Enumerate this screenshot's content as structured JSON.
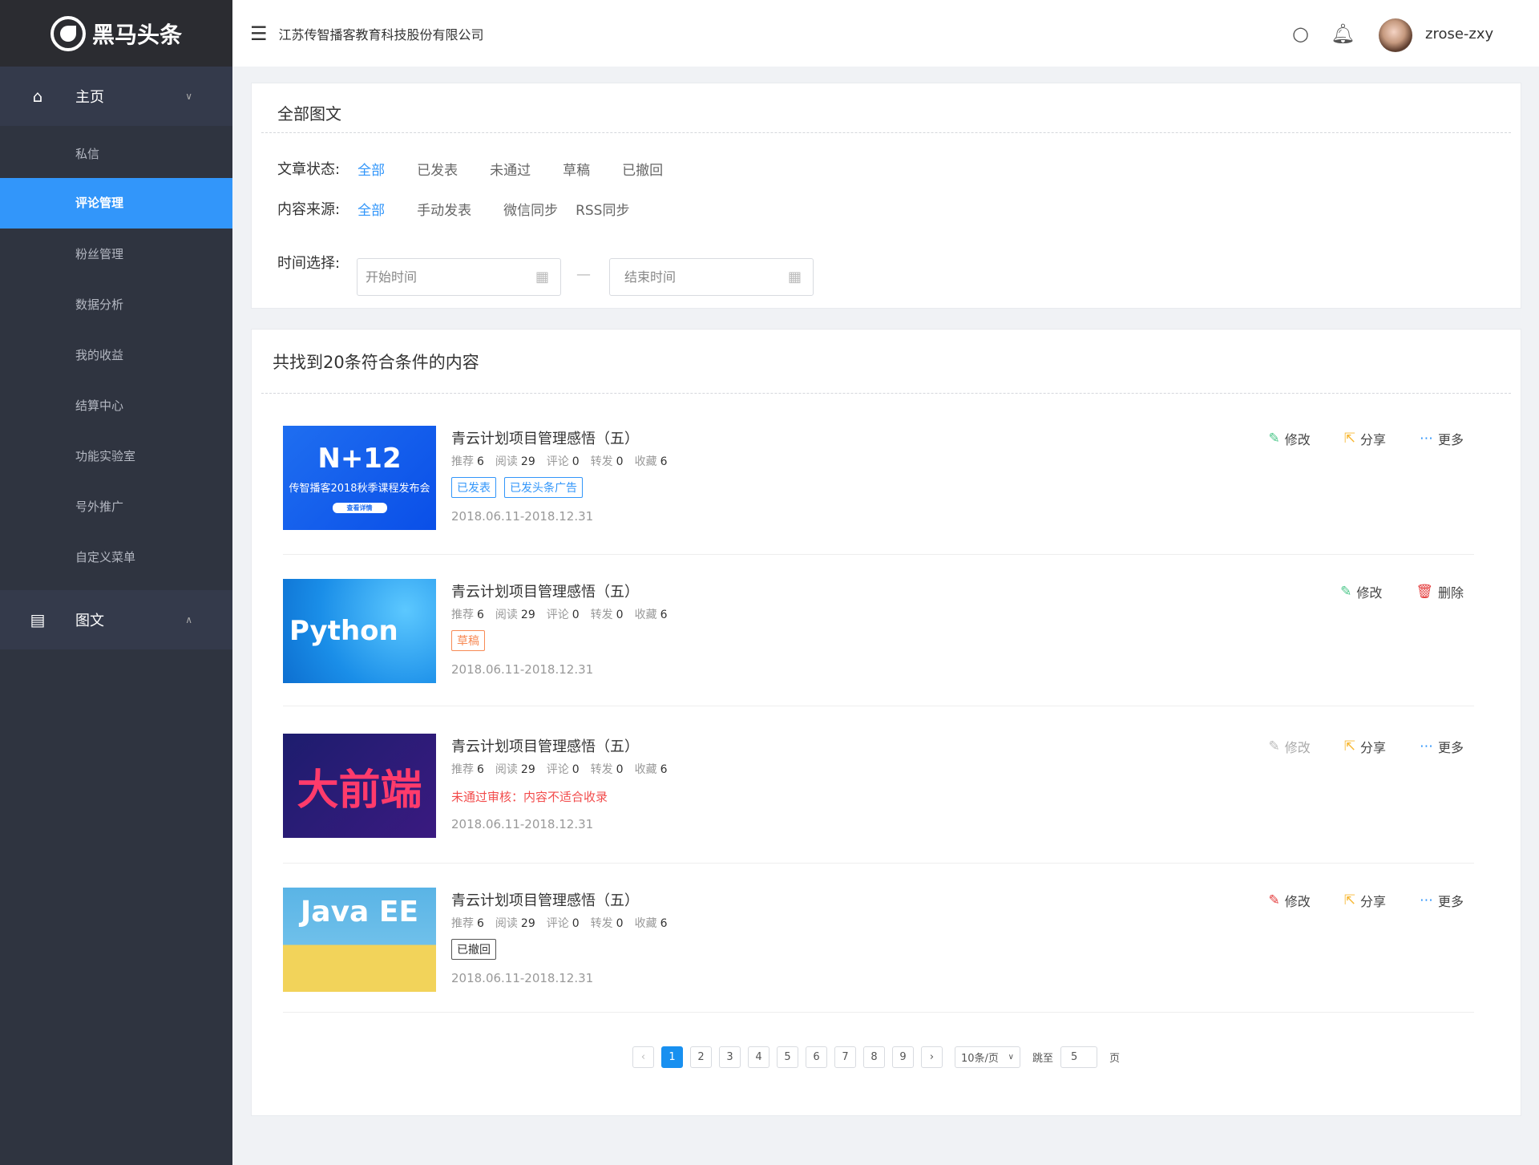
{
  "app": {
    "logo_text": "黑马头条",
    "company": "江苏传智播客教育科技股份有限公司",
    "username": "zrose-zxy"
  },
  "sidebar": {
    "groups": [
      {
        "label": "主页",
        "icon": "home-icon",
        "expanded": true
      },
      {
        "label": "图文",
        "icon": "document-icon",
        "expanded": false
      }
    ],
    "items": [
      {
        "label": "私信"
      },
      {
        "label": "评论管理",
        "active": true
      },
      {
        "label": "粉丝管理"
      },
      {
        "label": "数据分析"
      },
      {
        "label": "我的收益"
      },
      {
        "label": "结算中心"
      },
      {
        "label": "功能实验室"
      },
      {
        "label": "号外推广"
      },
      {
        "label": "自定义菜单"
      }
    ]
  },
  "filter": {
    "title": "全部图文",
    "status_label": "文章状态:",
    "status_options": [
      "全部",
      "已发表",
      "未通过",
      "草稿",
      "已撤回"
    ],
    "source_label": "内容来源:",
    "source_options": [
      "全部",
      "手动发表",
      "微信同步",
      "RSS同步"
    ],
    "time_label": "时间选择:",
    "start_placeholder": "开始时间",
    "end_placeholder": "结束时间",
    "dash": "—"
  },
  "results": {
    "title": "共找到20条符合条件的内容",
    "items": [
      {
        "image": {
          "text": "N+12",
          "sub": "传智播客2018秋季课程发布会",
          "button": "查看详情"
        },
        "title": "青云计划项目管理感悟（五）",
        "stats": [
          [
            "推荐",
            "6"
          ],
          [
            "阅读",
            "29"
          ],
          [
            "评论",
            "0"
          ],
          [
            "转发",
            "0"
          ],
          [
            "收藏",
            "6"
          ]
        ],
        "tags": [
          "已发表",
          "已发头条广告"
        ],
        "date": "2018.06.11-2018.12.31",
        "actions": [
          "修改",
          "分享",
          "更多"
        ]
      },
      {
        "image": {
          "text": "Python"
        },
        "title": "青云计划项目管理感悟（五）",
        "stats": [
          [
            "推荐",
            "6"
          ],
          [
            "阅读",
            "29"
          ],
          [
            "评论",
            "0"
          ],
          [
            "转发",
            "0"
          ],
          [
            "收藏",
            "6"
          ]
        ],
        "tags": [
          "草稿"
        ],
        "date": "2018.06.11-2018.12.31",
        "actions": [
          "修改",
          "删除"
        ]
      },
      {
        "image": {
          "text": "大前端"
        },
        "title": "青云计划项目管理感悟（五）",
        "stats": [
          [
            "推荐",
            "6"
          ],
          [
            "阅读",
            "29"
          ],
          [
            "评论",
            "0"
          ],
          [
            "转发",
            "0"
          ],
          [
            "收藏",
            "6"
          ]
        ],
        "reject": "未通过审核：内容不适合收录",
        "date": "2018.06.11-2018.12.31",
        "actions": [
          "修改",
          "分享",
          "更多"
        ]
      },
      {
        "image": {
          "text": "Java EE"
        },
        "title": "青云计划项目管理感悟（五）",
        "stats": [
          [
            "推荐",
            "6"
          ],
          [
            "阅读",
            "29"
          ],
          [
            "评论",
            "0"
          ],
          [
            "转发",
            "0"
          ],
          [
            "收藏",
            "6"
          ]
        ],
        "tags": [
          "已撤回"
        ],
        "date": "2018.06.11-2018.12.31",
        "actions": [
          "修改",
          "分享",
          "更多"
        ]
      }
    ]
  },
  "pagination": {
    "prev": "‹",
    "next": "›",
    "pages": [
      "1",
      "2",
      "3",
      "4",
      "5",
      "6",
      "7",
      "8",
      "9"
    ],
    "current": "1",
    "page_size": "10条/页",
    "jump_label": "跳至",
    "jump_value": "5",
    "page_unit": "页"
  },
  "colors": {
    "accent": "#3296fa",
    "sidebar": "#2f3440",
    "edit": "#4cc78a",
    "share": "#f7b731",
    "more": "#3296fa",
    "delete": "#e43c3c",
    "reject": "#f24b4b"
  }
}
